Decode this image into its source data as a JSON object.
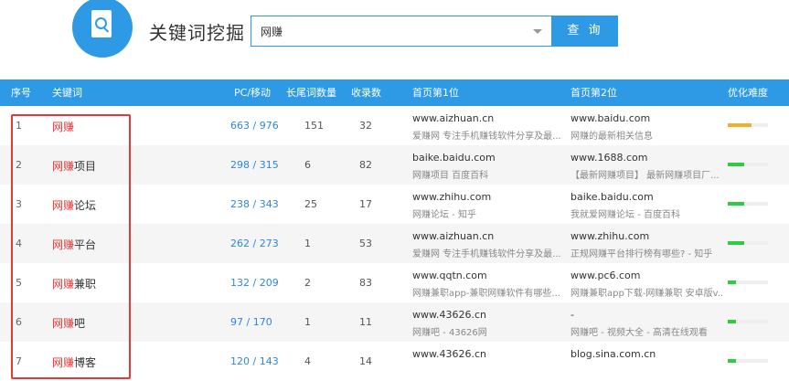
{
  "app": {
    "title": "关键词挖掘",
    "logo_icon": "document-search-icon",
    "accent_color": "#2e9ae6",
    "highlight_color": "#e53935"
  },
  "search": {
    "value": "网赚",
    "button_label": "查 询"
  },
  "table": {
    "headers": [
      "序号",
      "关键词",
      "PC/移动",
      "长尾词数量",
      "收录数",
      "首页第1位",
      "首页第2位",
      "优化难度"
    ],
    "rows": [
      {
        "index": "1",
        "kw_highlight": "网赚",
        "kw_rest": "",
        "pc_mobile": "663 / 976",
        "longtail": "151",
        "indexed": "32",
        "rank1_url": "www.aizhuan.cn",
        "rank1_desc": "爱赚网 专注手机赚钱软件分享及最...",
        "rank2_url": "www.baidu.com",
        "rank2_desc": "网赚的最新相关信息",
        "difficulty": 0.6,
        "difficulty_color": "#f0ad2e"
      },
      {
        "index": "2",
        "kw_highlight": "网赚",
        "kw_rest": "项目",
        "pc_mobile": "298 / 315",
        "longtail": "6",
        "indexed": "82",
        "rank1_url": "baike.baidu.com",
        "rank1_desc": "网赚项目 百度百科",
        "rank2_url": "www.1688.com",
        "rank2_desc": "【最新网赚项目】 最新网赚项目厂...",
        "difficulty": 0.4,
        "difficulty_color": "#2ecc40"
      },
      {
        "index": "3",
        "kw_highlight": "网赚",
        "kw_rest": "论坛",
        "pc_mobile": "238 / 343",
        "longtail": "25",
        "indexed": "17",
        "rank1_url": "www.zhihu.com",
        "rank1_desc": "网赚论坛 - 知乎",
        "rank2_url": "baike.baidu.com",
        "rank2_desc": "我就爱网赚论坛 - 百度百科",
        "difficulty": 0.4,
        "difficulty_color": "#2ecc40"
      },
      {
        "index": "4",
        "kw_highlight": "网赚",
        "kw_rest": "平台",
        "pc_mobile": "262 / 273",
        "longtail": "1",
        "indexed": "53",
        "rank1_url": "www.aizhuan.cn",
        "rank1_desc": "爱赚网 专注手机赚钱软件分享及最...",
        "rank2_url": "www.zhihu.com",
        "rank2_desc": "正规网赚平台排行榜有哪些? - 知乎",
        "difficulty": 0.4,
        "difficulty_color": "#2ecc40"
      },
      {
        "index": "5",
        "kw_highlight": "网赚",
        "kw_rest": "兼职",
        "pc_mobile": "132 / 209",
        "longtail": "2",
        "indexed": "83",
        "rank1_url": "www.qqtn.com",
        "rank1_desc": "网赚兼职app-兼职网赚软件有哪些...",
        "rank2_url": "www.pc6.com",
        "rank2_desc": "网赚兼职app下载-网赚兼职 安卓版v...",
        "difficulty": 0.2,
        "difficulty_color": "#2ecc40"
      },
      {
        "index": "6",
        "kw_highlight": "网赚",
        "kw_rest": "吧",
        "pc_mobile": "97 / 170",
        "longtail": "1",
        "indexed": "11",
        "rank1_url": "www.43626.cn",
        "rank1_desc": "网赚吧 - 43626网",
        "rank2_url": "-",
        "rank2_desc": "网赚吧 - 视频大全 - 高清在线观看",
        "difficulty": 0.2,
        "difficulty_color": "#2ecc40"
      },
      {
        "index": "7",
        "kw_highlight": "网赚",
        "kw_rest": "博客",
        "pc_mobile": "120 / 143",
        "longtail": "4",
        "indexed": "14",
        "rank1_url": "www.43626.cn",
        "rank1_desc": "",
        "rank2_url": "blog.sina.com.cn",
        "rank2_desc": "",
        "difficulty": 0.2,
        "difficulty_color": "#2ecc40"
      }
    ]
  }
}
